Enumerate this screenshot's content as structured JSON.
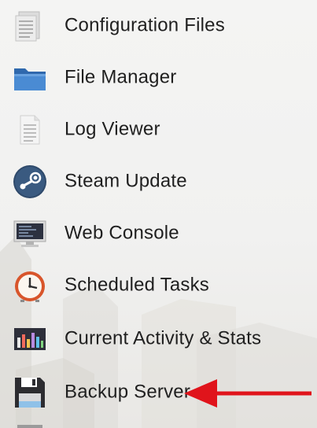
{
  "menu": {
    "items": [
      {
        "label": "Configuration Files",
        "icon": "configuration-files-icon"
      },
      {
        "label": "File Manager",
        "icon": "folder-icon"
      },
      {
        "label": "Log Viewer",
        "icon": "log-document-icon"
      },
      {
        "label": "Steam Update",
        "icon": "steam-icon"
      },
      {
        "label": "Web Console",
        "icon": "monitor-console-icon"
      },
      {
        "label": "Scheduled Tasks",
        "icon": "clock-icon"
      },
      {
        "label": "Current Activity & Stats",
        "icon": "bar-chart-icon"
      },
      {
        "label": "Backup Server",
        "icon": "floppy-disk-icon"
      }
    ]
  },
  "annotation": {
    "pointer": "red-arrow-icon",
    "color": "#e0141b"
  },
  "colors": {
    "text": "#1f1f1f",
    "background": "#f1f1f0",
    "folder": "#3f7dc4",
    "steam": "#2f4a6b",
    "clock": "#d8552b"
  }
}
